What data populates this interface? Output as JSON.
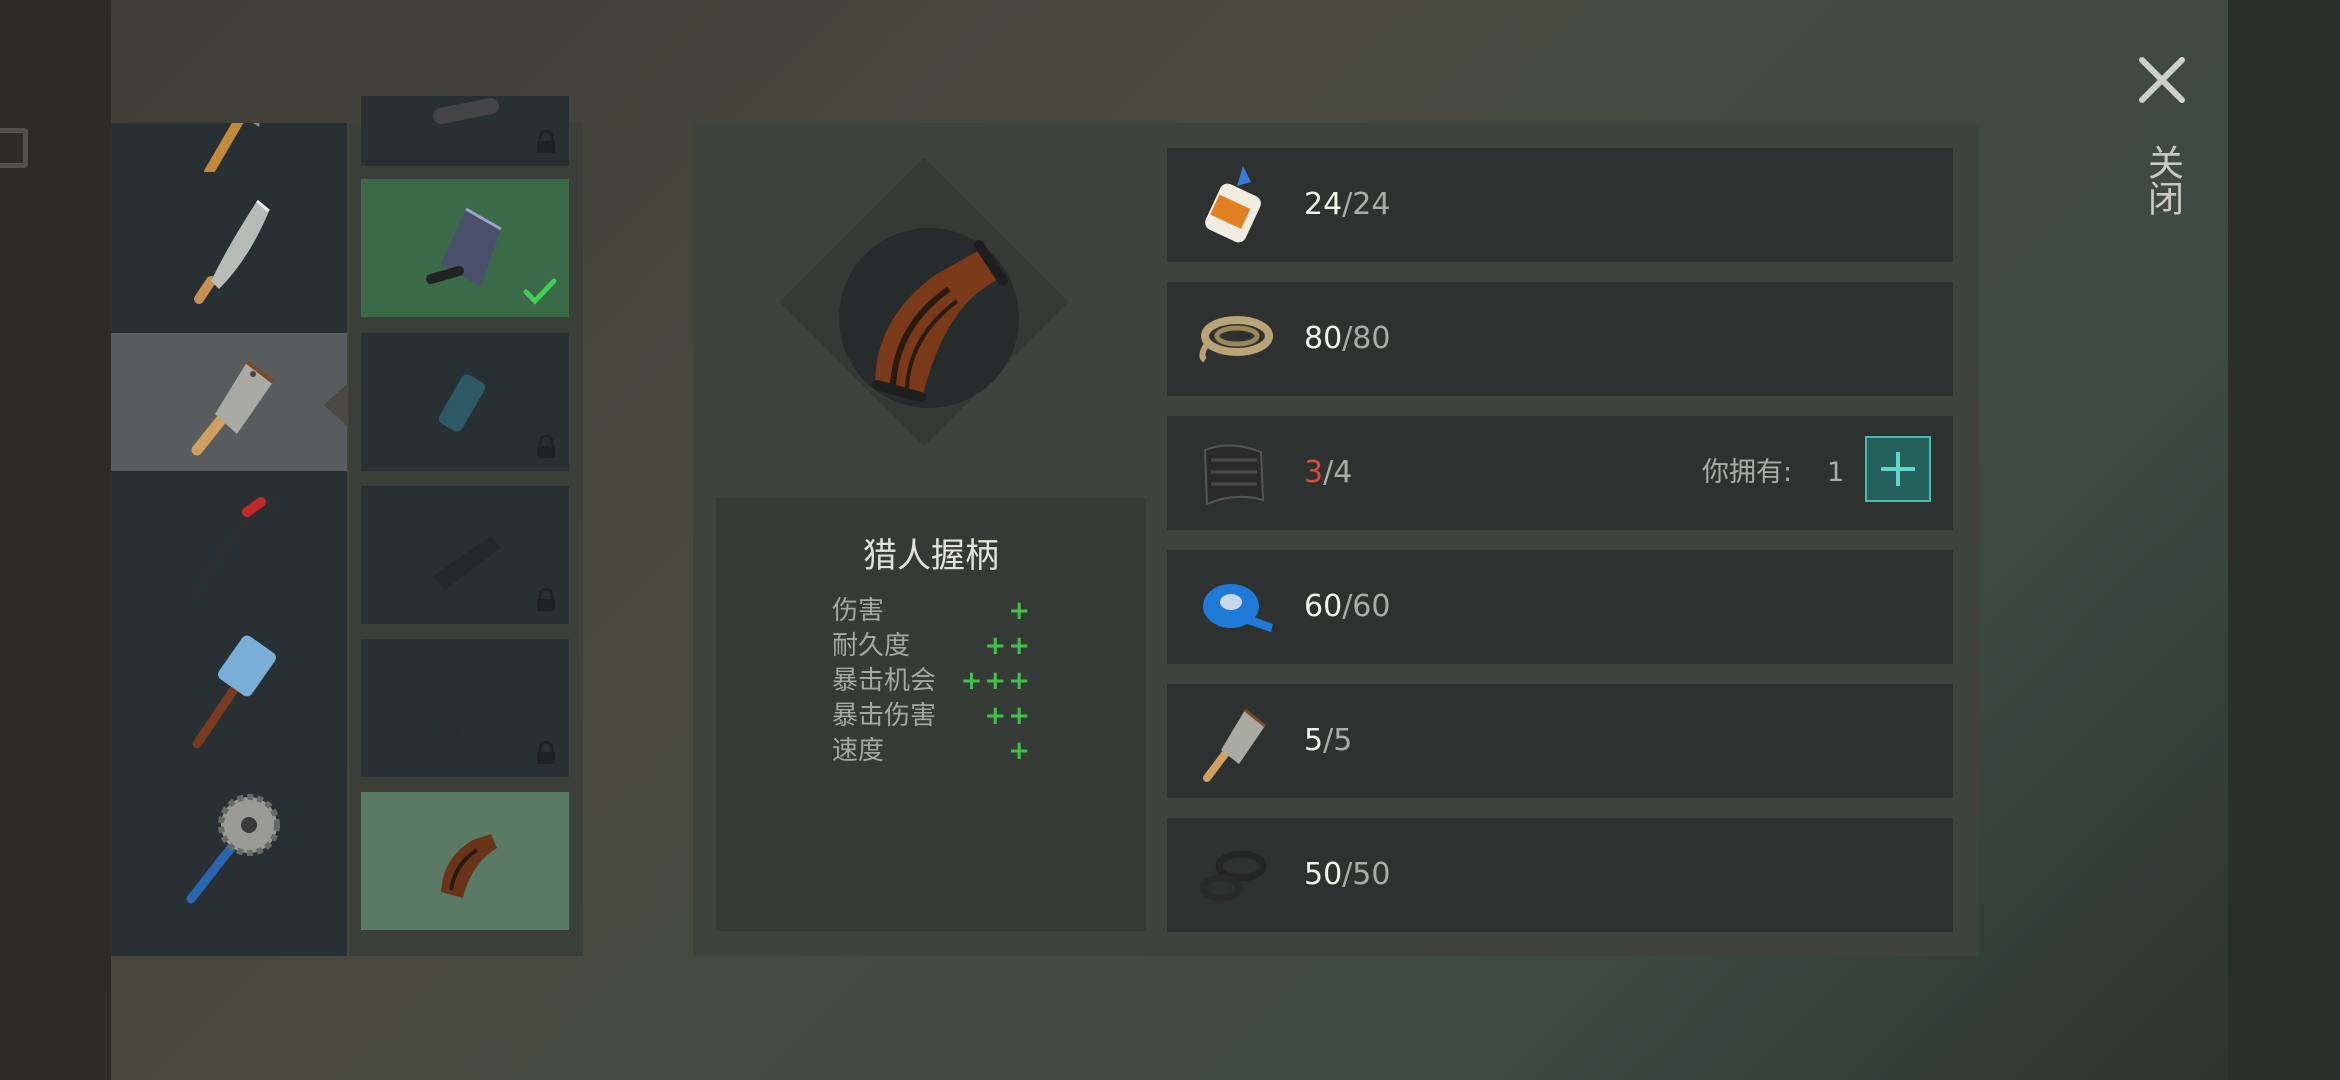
{
  "window": {
    "close_label": "关闭"
  },
  "weapons": [
    {
      "icon": "hatchet-icon",
      "selected": false
    },
    {
      "icon": "machete-icon",
      "selected": false
    },
    {
      "icon": "cleaver-icon",
      "selected": true
    },
    {
      "icon": "crowbar-icon",
      "selected": false
    },
    {
      "icon": "sledgehammer-icon",
      "selected": false
    },
    {
      "icon": "saw-mace-icon",
      "selected": false
    }
  ],
  "handle_options": [
    {
      "icon": "handle-icon",
      "state": "locked"
    },
    {
      "icon": "blade-handle-icon",
      "state": "equipped"
    },
    {
      "icon": "grip-icon",
      "state": "locked"
    },
    {
      "icon": "tactical-grip-icon",
      "state": "locked"
    },
    {
      "icon": "rubber-grip-icon",
      "state": "locked"
    },
    {
      "icon": "hunter-grip-icon",
      "state": "current"
    }
  ],
  "item": {
    "name": "猎人握柄",
    "stats": [
      {
        "name": "伤害",
        "value": "+"
      },
      {
        "name": "耐久度",
        "value": "++"
      },
      {
        "name": "暴击机会",
        "value": "+++"
      },
      {
        "name": "暴击伤害",
        "value": "++"
      },
      {
        "name": "速度",
        "value": "+"
      }
    ]
  },
  "requirements": [
    {
      "icon": "glue-icon",
      "have": "24",
      "sep": "/",
      "need": "24"
    },
    {
      "icon": "rope-icon",
      "have": "80",
      "sep": "/",
      "need": "80"
    },
    {
      "icon": "carbon-fiber-icon",
      "have": "3",
      "sep": "/",
      "need": "4",
      "owned_label": "你拥有:",
      "owned_value": "1"
    },
    {
      "icon": "tape-icon",
      "have": "60",
      "sep": "/",
      "need": "60"
    },
    {
      "icon": "cleaver-icon",
      "have": "5",
      "sep": "/",
      "need": "5"
    },
    {
      "icon": "rubber-rings-icon",
      "have": "50",
      "sep": "/",
      "need": "50"
    }
  ],
  "colors": {
    "accent_green": "#42c04a",
    "shortage_red": "#d84a3a",
    "add_button": "#24605c"
  }
}
